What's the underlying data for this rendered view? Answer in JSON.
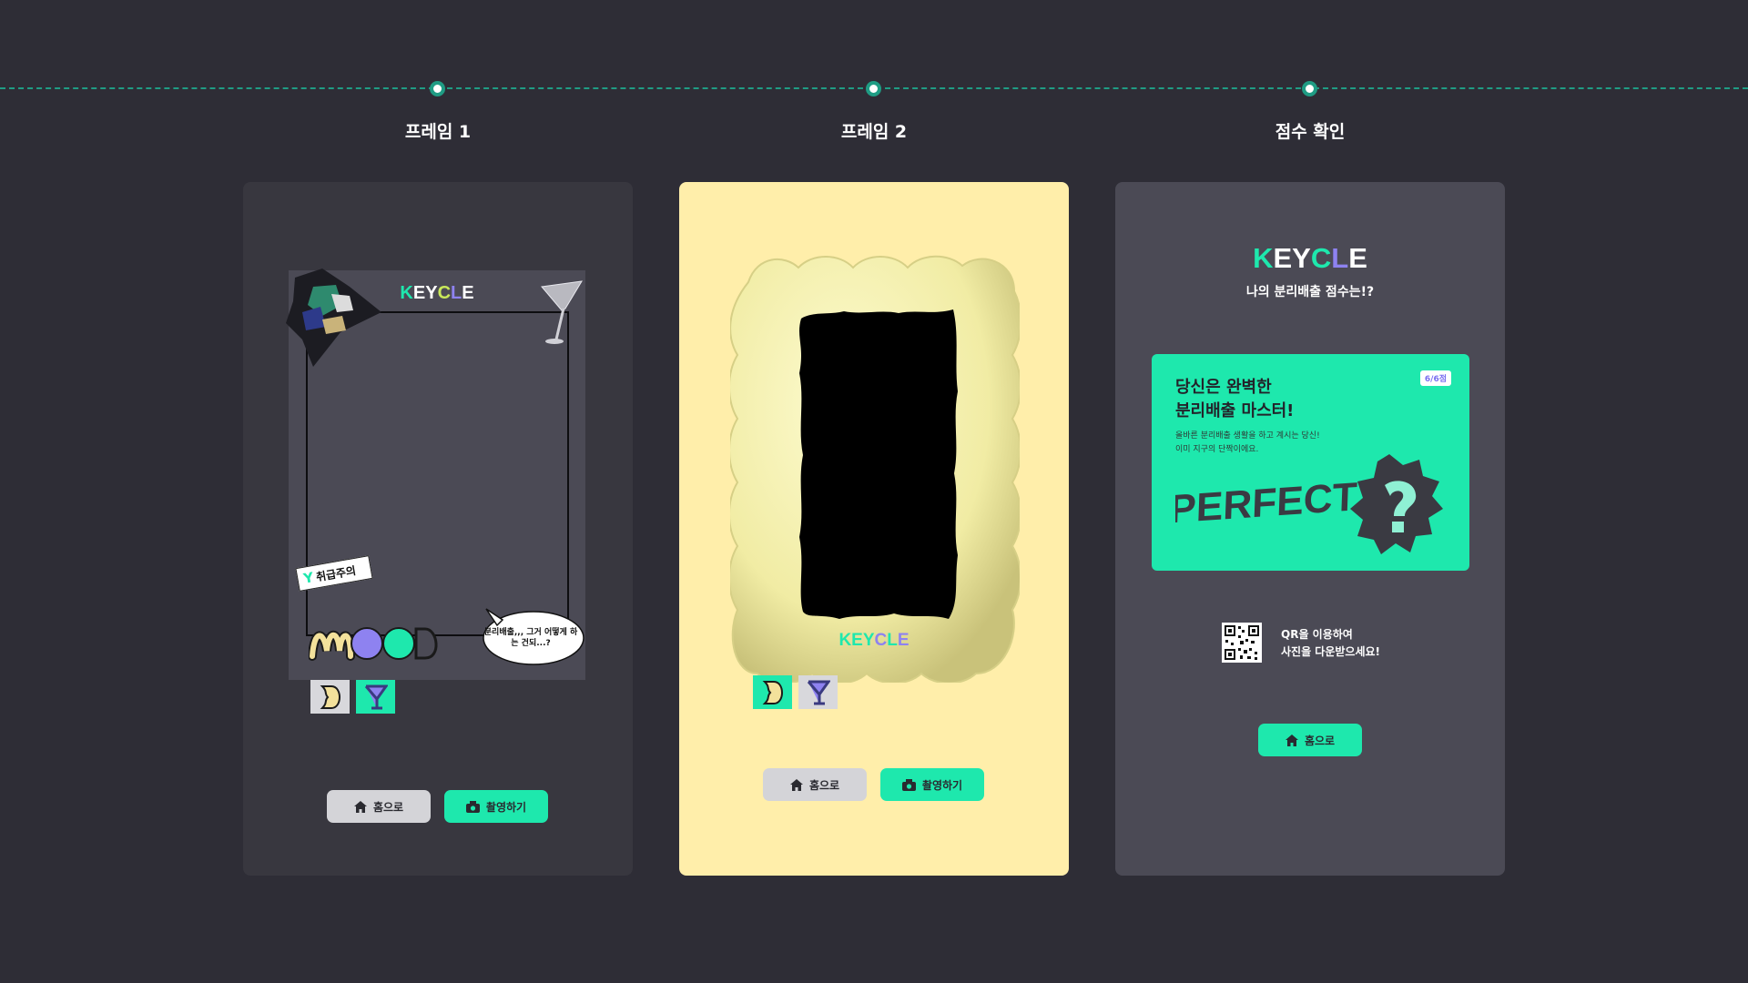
{
  "steps": [
    {
      "label": "프레임 1"
    },
    {
      "label": "프레임 2"
    },
    {
      "label": "점수 확인"
    }
  ],
  "brand": {
    "logo_text": "KEYCLE"
  },
  "frame1": {
    "caution_sticker": "취급주의",
    "speech_text": "분리배출,,, 그거 어떻게 하는 건되...?",
    "buttons": {
      "home": "홈으로",
      "capture": "촬영하기"
    }
  },
  "frame2": {
    "buttons": {
      "home": "홈으로",
      "capture": "촬영하기"
    }
  },
  "score": {
    "subtitle": "나의 분리배출 점수는!?",
    "badge": "6/6점",
    "title_line1": "당신은 완벽한",
    "title_line2": "분리배출 마스터!",
    "desc_line1": "올바른 분리배출 생활을 하고 계시는 당신!",
    "desc_line2": "이미 지구의 단짝이에요.",
    "perfect_word": "PERFECT",
    "qr_line1": "QR을 이용하여",
    "qr_line2": "사진을 다운받으세요!",
    "home_button": "홈으로"
  },
  "colors": {
    "background": "#2e2d36",
    "accent_green": "#1ee8ad",
    "accent_purple": "#8e82f0",
    "frame2_bg": "#ffeeaa"
  }
}
